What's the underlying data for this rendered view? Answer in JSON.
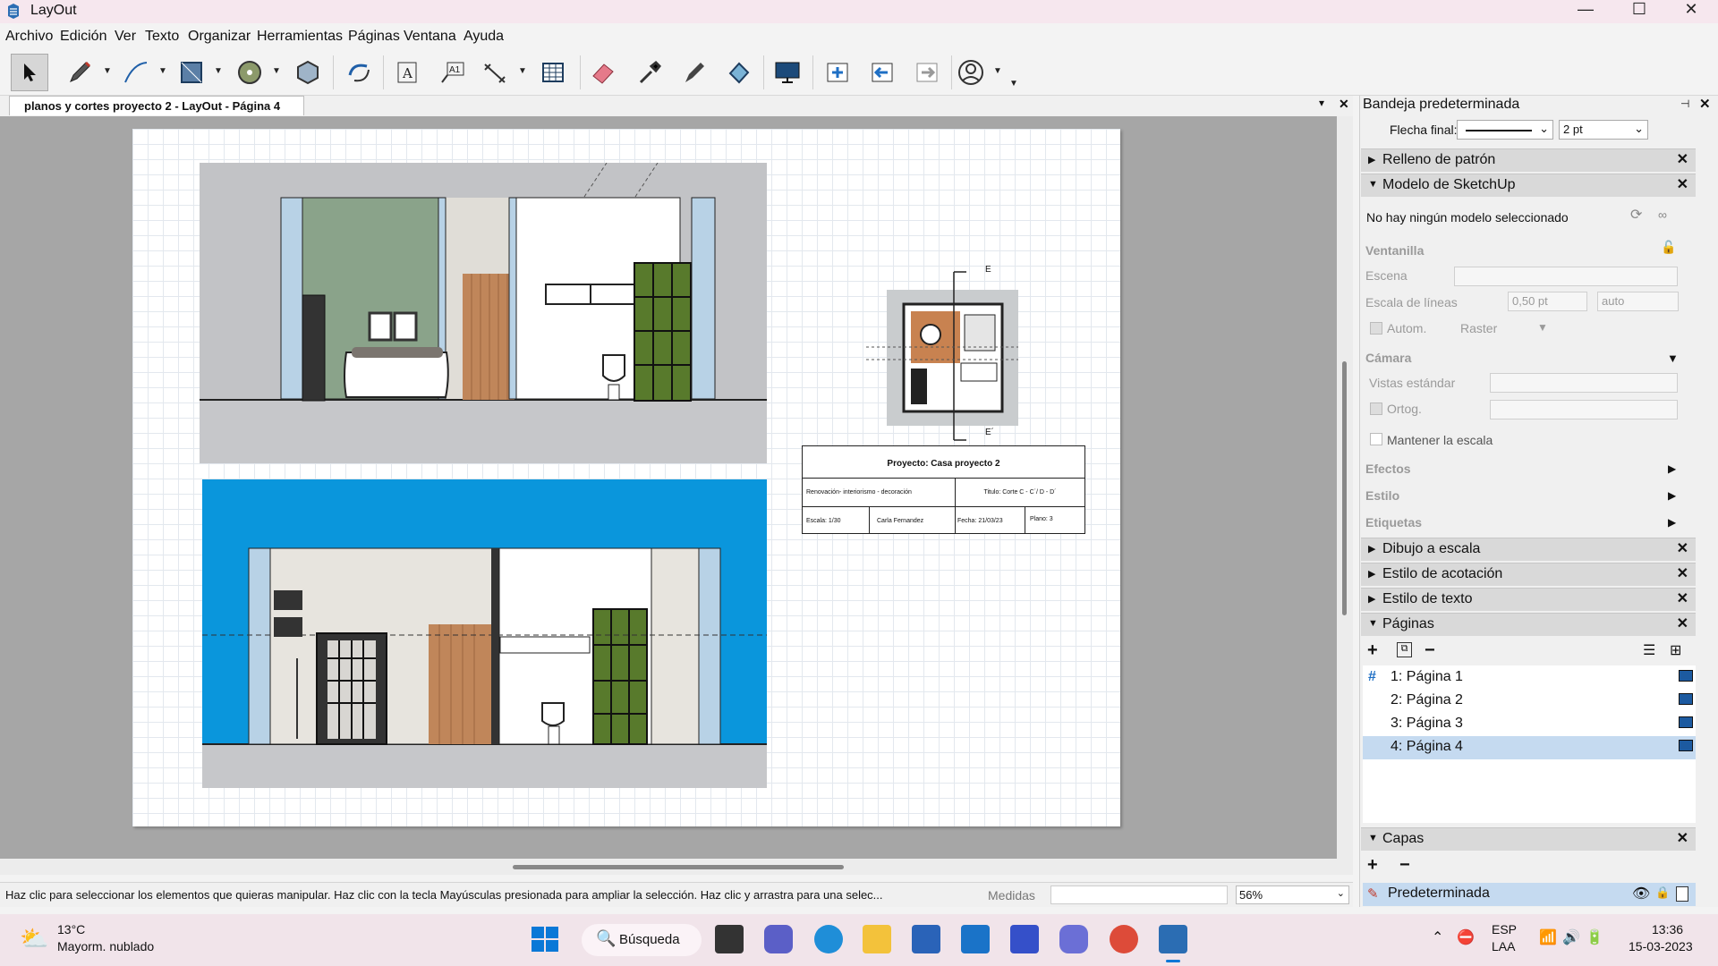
{
  "window": {
    "title": "LayOut",
    "minimize": "—",
    "maximize": "☐",
    "close": "✕"
  },
  "menu": [
    "Archivo",
    "Edición",
    "Ver",
    "Texto",
    "Organizar",
    "Herramientas",
    "Páginas",
    "Ventana",
    "Ayuda"
  ],
  "toolbar_icons": [
    "select-icon",
    "pencil-icon",
    "line-icon",
    "rectangle-icon",
    "circle-icon",
    "polygon-icon",
    "orbit-icon",
    "text-icon",
    "label-icon",
    "dimension-icon",
    "table-icon",
    "eraser-icon",
    "eyedropper-icon",
    "style-pen-icon",
    "paint-bucket-icon",
    "presentation-icon",
    "add-page-icon",
    "previous-page-icon",
    "next-page-icon",
    "account-icon"
  ],
  "document_tab": {
    "label": "planos y cortes proyecto 2 - LayOut - Página 4",
    "caret": "▾",
    "close": "✕"
  },
  "title_block": {
    "project": "Proyecto: Casa proyecto 2",
    "description": "Renovación- interiorismo - decoración",
    "sheet_title": "Titulo: Corte C - C´/ D - D´",
    "scale": "Escala: 1/30",
    "author": "Carla Fernandez",
    "date": "Fecha: 21/03/23",
    "plan": "Plano: 3"
  },
  "plan_labels": {
    "top": "E",
    "bottom": "E´"
  },
  "status": {
    "message": "Haz clic para seleccionar los elementos que quieras manipular. Haz clic con la tecla Mayúsculas presionada para ampliar la selección. Haz clic y arrastra para una selec...",
    "measures_label": "Medidas",
    "zoom": "56%"
  },
  "tray": {
    "title": "Bandeja predeterminada",
    "arrow_label": "Flecha final:",
    "arrow_size": "2 pt",
    "sections": {
      "pattern_fill": "Relleno de patrón",
      "sketchup_model": "Modelo de SketchUp",
      "scaled_drawing": "Dibujo a escala",
      "dimension_style": "Estilo de acotación",
      "text_style": "Estilo de texto",
      "pages": "Páginas",
      "layers": "Capas"
    },
    "model": {
      "no_model": "No hay ningún modelo seleccionado",
      "viewport": "Ventanilla",
      "scene": "Escena",
      "line_scale": "Escala de líneas",
      "line_value": "0,50 pt",
      "line_auto": "auto",
      "auto": "Autom.",
      "render": "Raster",
      "camera": "Cámara",
      "standard_views": "Vistas estándar",
      "ortho": "Ortog.",
      "keep_scale": "Mantener la escala",
      "effects": "Efectos",
      "style": "Estilo",
      "tags": "Etiquetas"
    },
    "pages": [
      "1: Página 1",
      "2: Página 2",
      "3: Página 3",
      "4: Página 4"
    ],
    "selected_page": "4: Página 4",
    "layer": "Predeterminada"
  },
  "taskbar": {
    "weather_temp": "13°C",
    "weather_desc": "Mayorm. nublado",
    "search": "Búsqueda",
    "lang": "ESP",
    "lang2": "LAA",
    "time": "13:36",
    "date": "15-03-2023"
  },
  "colors": {
    "accent_blue": "#0a96dc",
    "selection": "#c5daf0",
    "wall_green": "#8aa48a",
    "cabinet_green": "#587a2c"
  }
}
